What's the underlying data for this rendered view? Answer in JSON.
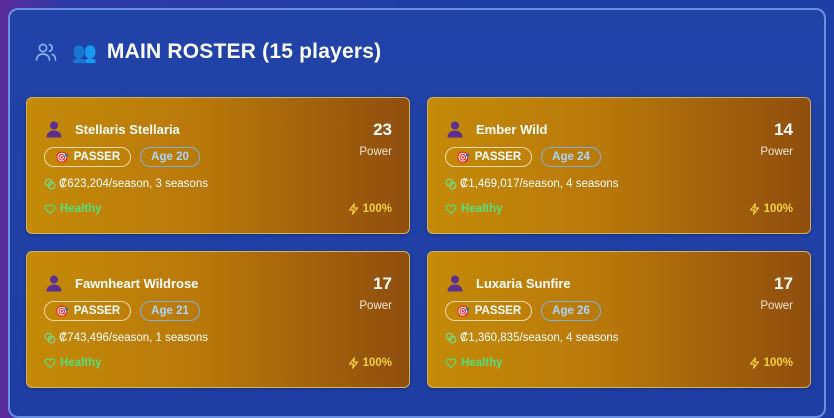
{
  "roster": {
    "emoji": "👥",
    "title": "MAIN ROSTER (15 players)",
    "power_label": "Power",
    "players": [
      {
        "name": "Stellaris Stellaria",
        "position": "PASSER",
        "age": "Age 20",
        "salary": "₡623,204/season, 3 seasons",
        "health": "Healthy",
        "power": "23",
        "energy": "100%"
      },
      {
        "name": "Ember Wild",
        "position": "PASSER",
        "age": "Age 24",
        "salary": "₡1,469,017/season, 4 seasons",
        "health": "Healthy",
        "power": "14",
        "energy": "100%"
      },
      {
        "name": "Fawnheart Wildrose",
        "position": "PASSER",
        "age": "Age 21",
        "salary": "₡743,496/season, 1 seasons",
        "health": "Healthy",
        "power": "17",
        "energy": "100%"
      },
      {
        "name": "Luxaria Sunfire",
        "position": "PASSER",
        "age": "Age 26",
        "salary": "₡1,360,835/season, 4 seasons",
        "health": "Healthy",
        "power": "17",
        "energy": "100%"
      }
    ]
  },
  "icons": {
    "header": "users-icon",
    "player": "person-icon",
    "position": "target-icon",
    "salary": "money-icon",
    "health": "heart-icon",
    "energy": "lightning-icon"
  },
  "colors": {
    "background": "#1f3fa6",
    "card_start": "#c48a08",
    "card_end": "#8f4e0e",
    "healthy": "#53e07b",
    "energy": "#f2d23a",
    "age_pill": "#a8d6ff"
  }
}
